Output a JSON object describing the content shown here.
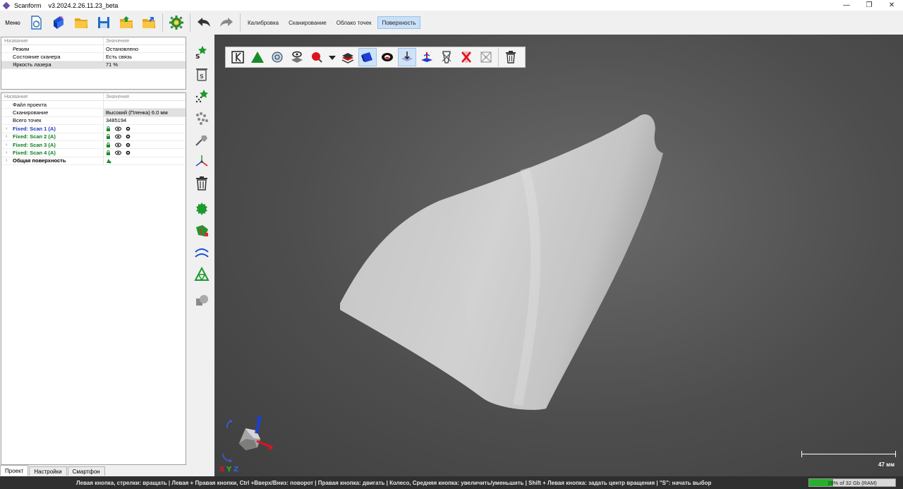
{
  "window": {
    "app_name": "Scanform",
    "version": "v3.2024.2.26.11.23_beta",
    "minimize": "—",
    "restore": "❐",
    "close": "✕"
  },
  "toolbar": {
    "menu_label": "Меню",
    "tabs": [
      "Калибровка",
      "Сканирование",
      "Облако точек",
      "Поверхность"
    ],
    "active_tab": "Поверхность"
  },
  "scanner_panel": {
    "headers": [
      "Название",
      "Значение"
    ],
    "rows": [
      {
        "name": "Режим",
        "value": "Остановлено"
      },
      {
        "name": "Состояние сканера",
        "value": "Есть связь"
      },
      {
        "name": "Яркость лазера",
        "value": "71 %"
      }
    ]
  },
  "project_panel": {
    "headers": [
      "Название",
      "Значение"
    ],
    "rows": [
      {
        "name": "Файл проекта",
        "value": ""
      },
      {
        "name": "Сканирование",
        "value": "Высокий (Пленка)  6.0 мм"
      },
      {
        "name": "Всего точек",
        "value": "3485194"
      }
    ],
    "scans": [
      {
        "name": "Fixed: Scan 1 (A)"
      },
      {
        "name": "Fixed: Scan 2 (A)"
      },
      {
        "name": "Fixed: Scan 3 (A)"
      },
      {
        "name": "Fixed: Scan 4 (A)"
      }
    ],
    "surface": {
      "name": "Общая поверхность"
    },
    "expand_glyph": "›"
  },
  "bottom_tabs": [
    "Проект",
    "Настройки",
    "Смартфон"
  ],
  "viewport": {
    "scale_label": "47 мм",
    "axis_label_x": "X",
    "axis_label_y": "Y",
    "axis_label_z": "Z"
  },
  "status": {
    "hints": "Левая кнопка, стрелки: вращать  |  Левая + Правая кнопки, Ctrl +Вверх/Вниз: поворот  |  Правая кнопка: двигать  |  Колесо, Средняя кнопка: увеличить/уменьшить  |  Shift + Левая кнопка: задать центр вращения  |  \"S\": начать выбор",
    "ram_text": "28% of 32 Gb (RAM)",
    "ram_fraction": 0.28
  },
  "colors": {
    "accent_green": "#27b02c",
    "scan_green": "#0b7d1c",
    "active_tab_bg": "#c9e0f7"
  },
  "icons": {
    "main_toolbar": [
      "new-project-icon",
      "import-icon",
      "open-folder-icon",
      "save-icon",
      "open-project-icon",
      "export-folder-icon",
      "settings-gear-icon",
      "undo-icon",
      "redo-icon"
    ],
    "vertical_tools": [
      "select-points-icon",
      "delete-selection-icon",
      "filter-points-icon",
      "noise-filter-icon",
      "pick-icon",
      "axes-icon",
      "trash-icon",
      "mesh-icon",
      "hole-fill-icon",
      "curve-icon",
      "triangulate-icon",
      "shapes-icon"
    ],
    "viewport_tools": [
      "frame-icon",
      "triangle-icon",
      "sphere-view-icon",
      "eye-layer-icon",
      "color-point-icon",
      "dropdown-icon",
      "layer-red-icon",
      "cube-blue-icon",
      "ring-icon",
      "arrow-down-icon",
      "plane-icon",
      "crossed-plane-icon",
      "red-x-icon",
      "grey-crossed-icon",
      "trash-icon"
    ]
  }
}
